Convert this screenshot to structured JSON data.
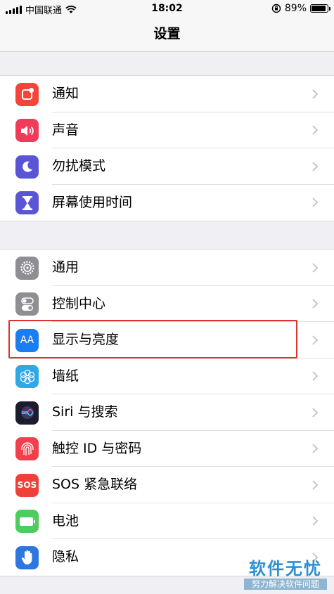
{
  "status_bar": {
    "carrier": "中国联通",
    "time": "18:02",
    "battery_percent_text": "89%",
    "battery_level": 0.89
  },
  "nav": {
    "title": "设置"
  },
  "groups": [
    {
      "items": [
        {
          "label": "通知",
          "icon": "notifications-icon",
          "color": "#f5453a"
        },
        {
          "label": "声音",
          "icon": "sounds-icon",
          "color": "#f23a5a"
        },
        {
          "label": "勿扰模式",
          "icon": "moon-icon",
          "color": "#5a54d6"
        },
        {
          "label": "屏幕使用时间",
          "icon": "hourglass-icon",
          "color": "#5a54d6"
        }
      ]
    },
    {
      "items": [
        {
          "label": "通用",
          "icon": "gear-icon",
          "color": "#8e8e93"
        },
        {
          "label": "控制中心",
          "icon": "toggles-icon",
          "color": "#8e8e93"
        },
        {
          "label": "显示与亮度",
          "icon": "text-size-icon",
          "color": "#1a7ef2"
        },
        {
          "label": "墙纸",
          "icon": "flower-icon",
          "color": "#2fa8e6"
        },
        {
          "label": "Siri 与搜索",
          "icon": "siri-icon",
          "color": "#1c1c2e"
        },
        {
          "label": "触控 ID 与密码",
          "icon": "fingerprint-icon",
          "color": "#f0404e"
        },
        {
          "label": "SOS 紧急联络",
          "icon": "sos-icon",
          "color": "#f0403a"
        },
        {
          "label": "电池",
          "icon": "battery-icon",
          "color": "#4ccd5e"
        },
        {
          "label": "隐私",
          "icon": "hand-icon",
          "color": "#2f76e0"
        }
      ]
    }
  ],
  "icon_text": {
    "display": "AA",
    "sos": "SOS"
  },
  "highlighted_item": "显示与亮度",
  "highlight_color": "#d9352f",
  "watermark": {
    "title": "软件无忧",
    "subtitle": "努力解决软件问题"
  }
}
